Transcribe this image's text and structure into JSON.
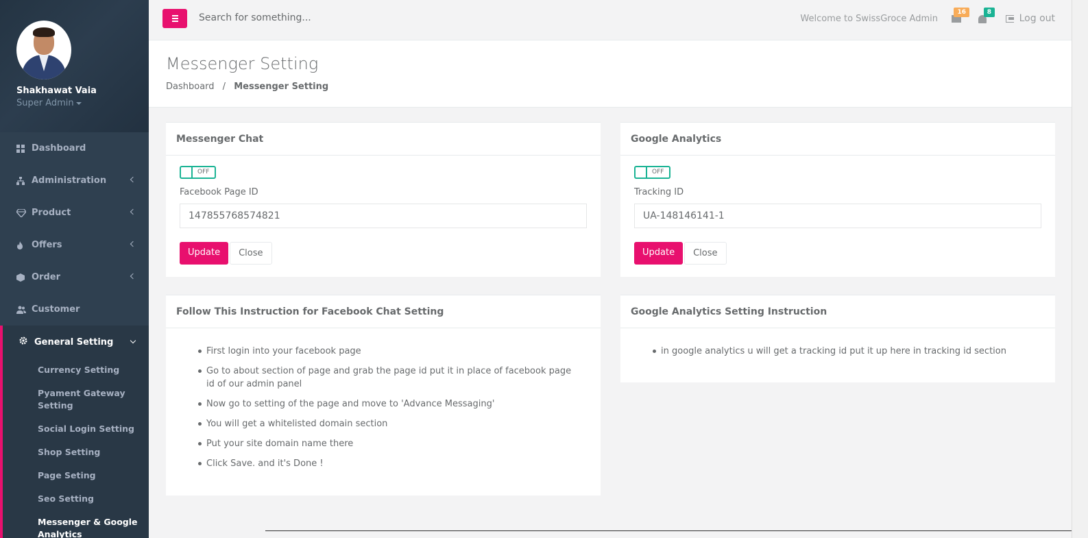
{
  "profile": {
    "name": "Shakhawat Vaia",
    "role": "Super Admin"
  },
  "nav": {
    "items": [
      {
        "label": "Dashboard",
        "icon": "dashboard-icon",
        "expandable": false
      },
      {
        "label": "Administration",
        "icon": "sitemap-icon",
        "expandable": true
      },
      {
        "label": "Product",
        "icon": "diamond-icon",
        "expandable": true
      },
      {
        "label": "Offers",
        "icon": "fire-icon",
        "expandable": true
      },
      {
        "label": "Order",
        "icon": "cube-icon",
        "expandable": true
      },
      {
        "label": "Customer",
        "icon": "users-icon",
        "expandable": false
      }
    ],
    "active": {
      "label": "General Setting",
      "icon": "gear-icon",
      "sub_items": [
        "Currency Setting",
        "Pyament Gateway Setting",
        "Social Login Setting",
        "Shop Setting",
        "Page Seting",
        "Seo Setting",
        "Messenger & Google Analytics"
      ]
    }
  },
  "topbar": {
    "search_placeholder": "Search for something...",
    "welcome": "Welcome to SwissGroce Admin",
    "messages_count": "16",
    "notifications_count": "8",
    "logout_label": "Log out",
    "badge_colors": {
      "messages": "#f8ac59",
      "notifications": "#1ab394"
    }
  },
  "heading": {
    "title": "Messenger Setting",
    "breadcrumb": {
      "home": "Dashboard",
      "separator": "/",
      "current": "Messenger Setting"
    }
  },
  "messenger": {
    "title": "Messenger Chat",
    "toggle_label": "OFF",
    "field_label": "Facebook Page ID",
    "field_value": "147855768574821",
    "update_label": "Update",
    "close_label": "Close"
  },
  "analytics": {
    "title": "Google Analytics",
    "toggle_label": "OFF",
    "field_label": "Tracking ID",
    "field_value": "UA-148146141-1",
    "update_label": "Update",
    "close_label": "Close"
  },
  "facebook_instructions": {
    "title": "Follow This Instruction for Facebook Chat Setting",
    "steps": [
      "First login into your facebook page",
      "Go to about section of page and grab the page id put it in place of facebook page id of our admin panel",
      "Now go to setting of the page and move to 'Advance Messaging'",
      "You will get a whitelisted domain section",
      "Put your site domain name there",
      "Click Save. and it's Done !"
    ]
  },
  "analytics_instructions": {
    "title": "Google Analytics Setting Instruction",
    "steps": [
      "in google analytics u will get a tracking id put it up here in tracking id section"
    ]
  },
  "colors": {
    "accent": "#e8106e",
    "sidebar": "#2f4050",
    "toggle": "#1ab394"
  }
}
